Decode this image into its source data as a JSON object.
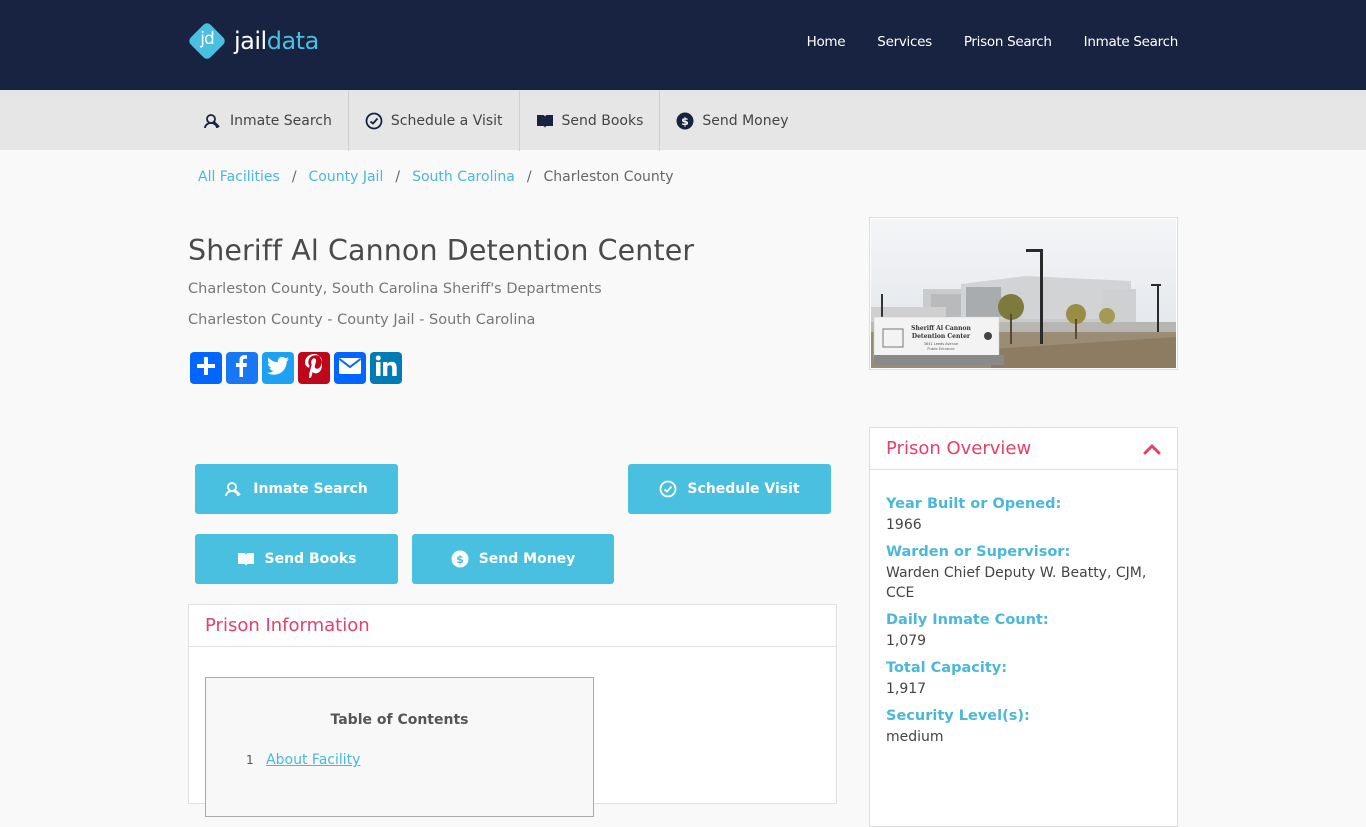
{
  "header": {
    "logo": {
      "mark": "jd",
      "text_primary": "jail",
      "text_accent": "data"
    },
    "nav": [
      "Home",
      "Services",
      "Prison Search",
      "Inmate Search"
    ]
  },
  "service_bar": [
    {
      "label": "Inmate Search",
      "icon": "inmate-search-icon"
    },
    {
      "label": "Schedule a Visit",
      "icon": "clock-icon"
    },
    {
      "label": "Send Books",
      "icon": "book-icon"
    },
    {
      "label": "Send Money",
      "icon": "dollar-icon"
    }
  ],
  "breadcrumb": {
    "items": [
      "All Facilities",
      "County Jail",
      "South Carolina"
    ],
    "separator": "/",
    "current": "Charleston County"
  },
  "facility": {
    "name": "Sheriff Al Cannon Detention Center",
    "subtitle1": "Charleston County, South Carolina Sheriff's Departments",
    "subtitle2": "Charleston County - County Jail - South Carolina",
    "image_sign_text": "Sheriff Al Cannon Detention Center"
  },
  "share": [
    {
      "name": "share",
      "icon": "plus-icon",
      "color": "#0166ff"
    },
    {
      "name": "facebook",
      "icon": "facebook-icon",
      "color": "#1877f2"
    },
    {
      "name": "twitter",
      "icon": "twitter-icon",
      "color": "#1da1f2"
    },
    {
      "name": "pinterest",
      "icon": "pinterest-icon",
      "color": "#bd081c"
    },
    {
      "name": "email",
      "icon": "email-icon",
      "color": "#0166ff"
    },
    {
      "name": "linkedin",
      "icon": "linkedin-icon",
      "color": "#007bb5"
    }
  ],
  "actions": {
    "inmate_search": "Inmate Search",
    "schedule_visit": "Schedule Visit",
    "send_books": "Send Books",
    "send_money": "Send Money"
  },
  "prison_information": {
    "title": "Prison Information",
    "toc_title": "Table of Contents",
    "toc_items": [
      {
        "num": "1",
        "label": "About Facility"
      }
    ]
  },
  "overview": {
    "title": "Prison Overview",
    "fields": [
      {
        "label": "Year Built or Opened:",
        "value": "1966"
      },
      {
        "label": "Warden or Supervisor:",
        "value": "Warden Chief Deputy W. Beatty, CJM, CCE"
      },
      {
        "label": "Daily Inmate Count:",
        "value": "1,079"
      },
      {
        "label": "Total Capacity:",
        "value": "1,917"
      },
      {
        "label": "Security Level(s):",
        "value": "medium"
      }
    ]
  },
  "colors": {
    "header_bg": "#172340",
    "accent": "#4ac0e0",
    "heading_pink": "#e63e6d",
    "service_bar_bg": "#e6e6e6"
  }
}
